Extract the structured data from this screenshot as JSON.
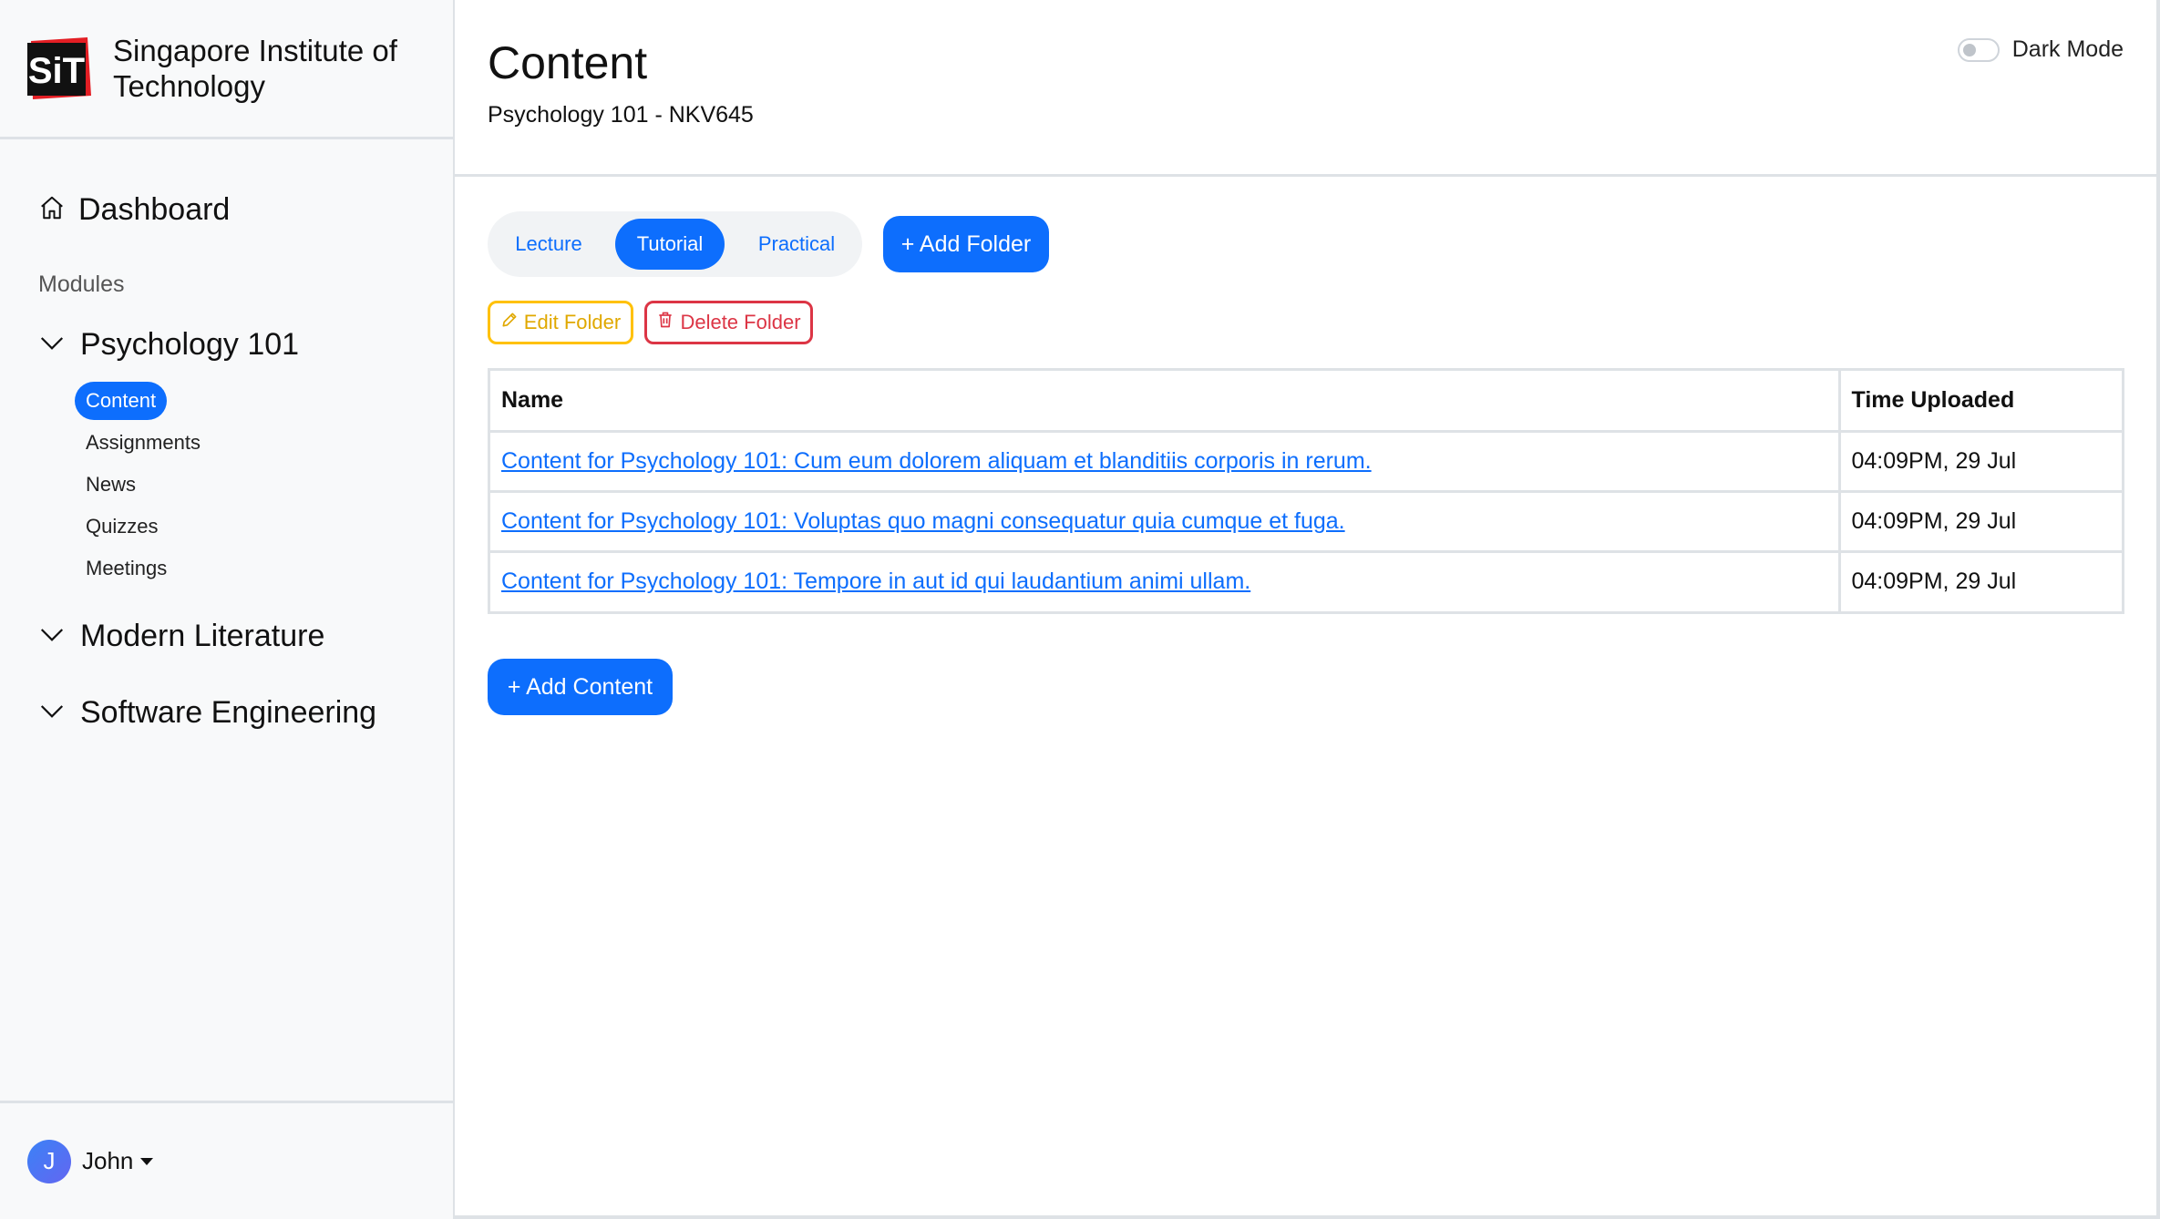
{
  "brand": {
    "name": "Singapore Institute of Technology",
    "logo_text": "SiT"
  },
  "sidebar": {
    "dashboard_label": "Dashboard",
    "modules_heading": "Modules",
    "modules": [
      {
        "label": "Psychology 101",
        "expanded": true,
        "items": [
          {
            "label": "Content",
            "active": true
          },
          {
            "label": "Assignments",
            "active": false
          },
          {
            "label": "News",
            "active": false
          },
          {
            "label": "Quizzes",
            "active": false
          },
          {
            "label": "Meetings",
            "active": false
          }
        ]
      },
      {
        "label": "Modern Literature",
        "expanded": false
      },
      {
        "label": "Software Engineering",
        "expanded": false
      }
    ],
    "user": {
      "initial": "J",
      "name": "John"
    }
  },
  "header": {
    "title": "Content",
    "subtitle": "Psychology 101 - NKV645",
    "dark_mode_label": "Dark Mode",
    "dark_mode_on": false
  },
  "folder_tabs": [
    {
      "label": "Lecture",
      "active": false
    },
    {
      "label": "Tutorial",
      "active": true
    },
    {
      "label": "Practical",
      "active": false
    }
  ],
  "actions": {
    "add_folder_label": "+ Add Folder",
    "edit_folder_label": "Edit Folder",
    "delete_folder_label": "Delete Folder",
    "add_content_label": "+ Add Content"
  },
  "table": {
    "columns": [
      "Name",
      "Time Uploaded"
    ],
    "rows": [
      {
        "name": "Content for Psychology 101: Cum eum dolorem aliquam et blanditiis corporis in rerum.",
        "time": "04:09PM, 29 Jul"
      },
      {
        "name": "Content for Psychology 101: Voluptas quo magni consequatur quia cumque et fuga.",
        "time": "04:09PM, 29 Jul"
      },
      {
        "name": "Content for Psychology 101: Tempore in aut id qui laudantium animi ullam.",
        "time": "04:09PM, 29 Jul"
      }
    ]
  },
  "colors": {
    "primary": "#0d6efd",
    "warning": "#ffc107",
    "danger": "#dc3545",
    "logo_red": "#e31e24"
  }
}
